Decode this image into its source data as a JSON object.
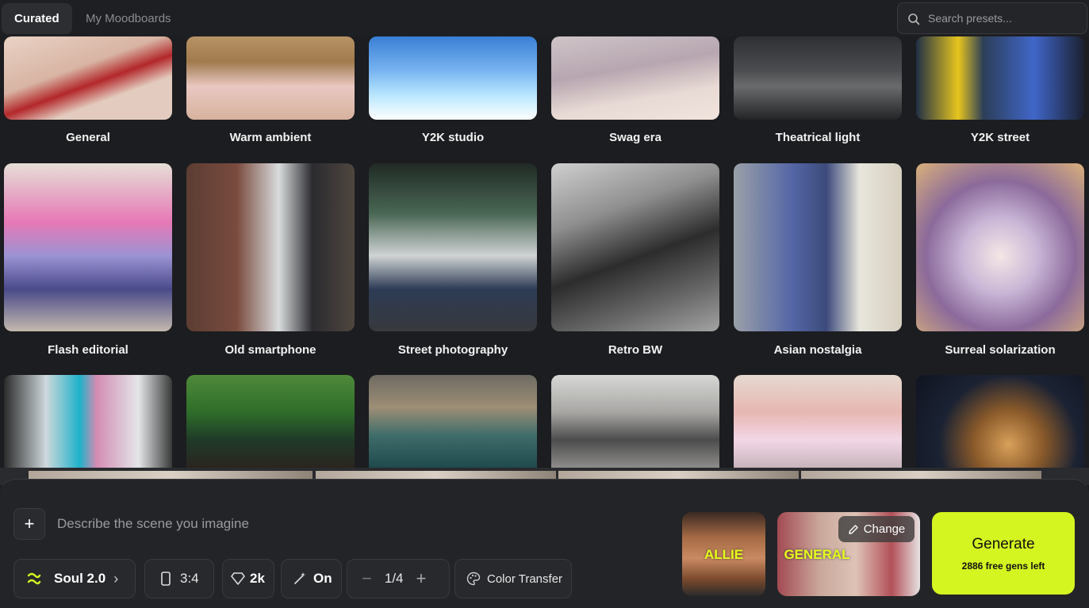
{
  "tabs": [
    {
      "label": "Curated",
      "active": true
    },
    {
      "label": "My Moodboards",
      "active": false
    }
  ],
  "search": {
    "placeholder": "Search presets..."
  },
  "presets": {
    "row1": [
      "General",
      "Warm ambient",
      "Y2K studio",
      "Swag era",
      "Theatrical light",
      "Y2K street"
    ],
    "row2": [
      "Flash editorial",
      "Old smartphone",
      "Street photography",
      "Retro BW",
      "Asian nostalgia",
      "Surreal solarization"
    ]
  },
  "composer": {
    "prompt_placeholder": "Describe the scene you imagine",
    "model_label": "Soul 2.0",
    "aspect_ratio": "3:4",
    "resolution": "2k",
    "enhance": "On",
    "batch": "1/4",
    "color_transfer_label": "Color Transfer",
    "character_label": "ALLIE",
    "preset_label": "GENERAL",
    "change_label": "Change",
    "generate_label": "Generate",
    "free_gens": "2886 free gens left"
  },
  "colors": {
    "accent": "#d5f520",
    "background": "#1c1d20",
    "highlight_text": "#e4ff1a"
  }
}
